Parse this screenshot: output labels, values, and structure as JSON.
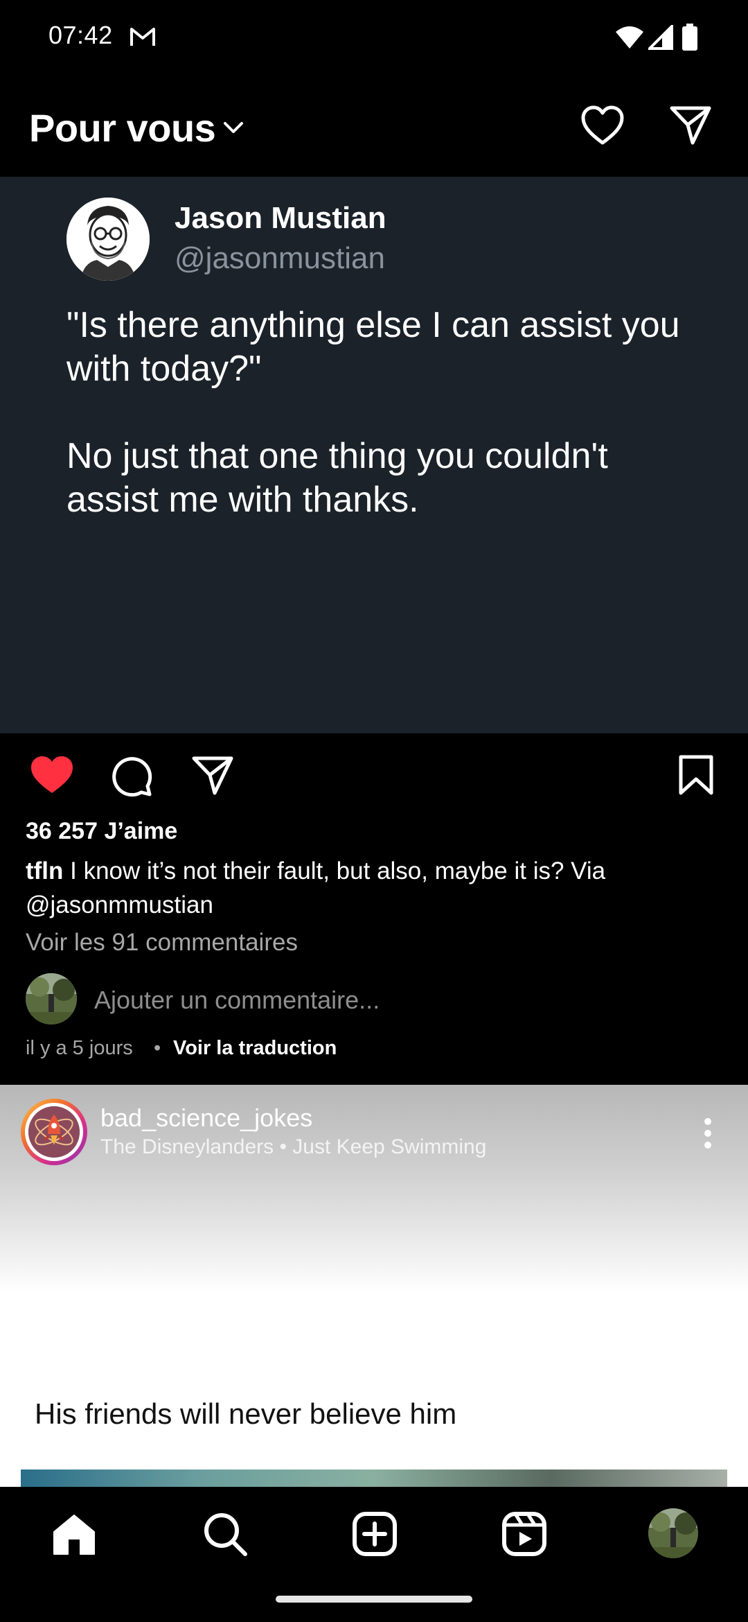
{
  "status_bar": {
    "time": "07:42",
    "icons": [
      "gmail-icon",
      "wifi-icon",
      "signal-icon",
      "battery-icon"
    ]
  },
  "header": {
    "title": "Pour vous",
    "icons": [
      "chevron-down-icon",
      "heart-icon",
      "send-icon"
    ]
  },
  "post1": {
    "tweet": {
      "name": "Jason Mustian",
      "handle": "@jasonmustian",
      "text": "\"Is there anything else I can assist you with today?\"\n\nNo just that one thing you couldn't assist me with thanks."
    },
    "likes": "36 257 J’aime",
    "caption_user": "tfln",
    "caption_text": " I know it’s not their fault, but also, maybe it is? Via @jasonmmustian",
    "view_comments": "Voir les 91 commentaires",
    "add_comment_placeholder": "Ajouter un commentaire...",
    "timestamp": "il y a 5 jours",
    "separator": "•",
    "translate": "Voir la traduction",
    "like_color": "#ff3040"
  },
  "post2": {
    "username": "bad_science_jokes",
    "subtitle": "The Disneylanders • Just Keep Swimming",
    "caption": "His friends will never believe him"
  },
  "bottom_nav": {
    "items": [
      "home-icon",
      "search-icon",
      "create-icon",
      "reels-icon",
      "profile-avatar"
    ]
  },
  "colors": {
    "background": "#000000",
    "tweet_card": "#1b222a",
    "handle_gray": "#8a939d",
    "like_red": "#ff3040"
  }
}
